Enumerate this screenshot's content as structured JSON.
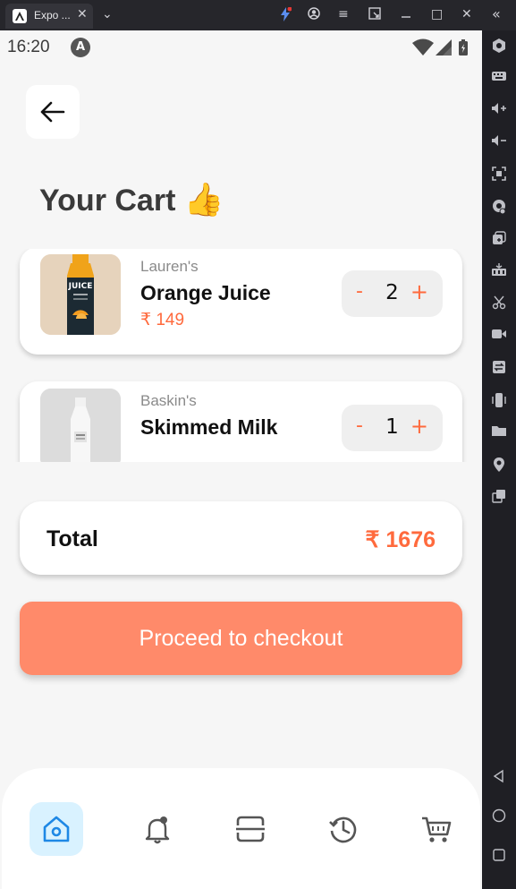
{
  "window": {
    "tab_title": "Expo ...",
    "tab_close": "✕",
    "tab_dropdown": "⌄",
    "controls": [
      "≡",
      "□",
      "✕",
      "«"
    ]
  },
  "status_bar": {
    "time": "16:20",
    "badge": "A"
  },
  "page": {
    "title": "Your Cart",
    "title_emoji": "👍"
  },
  "cart": {
    "items": [
      {
        "brand": "Lauren's",
        "name": "Orange Juice",
        "price": "₹ 149",
        "quantity": "2",
        "image": "juice-bottle"
      },
      {
        "brand": "Baskin's",
        "name": "Skimmed Milk",
        "price": "",
        "quantity": "1",
        "image": "milk-bottle"
      }
    ],
    "minus_label": "-",
    "plus_label": "+",
    "juice_label": "JUICE"
  },
  "total": {
    "label": "Total",
    "value": "₹ 1676"
  },
  "checkout": {
    "label": "Proceed to checkout"
  },
  "nav": {
    "items": [
      "home-icon",
      "bell-icon",
      "scan-icon",
      "history-icon",
      "cart-icon"
    ],
    "active": "home-icon"
  },
  "colors": {
    "accent": "#ff6a3d",
    "checkout_bg": "#ff8a6a",
    "nav_active_bg": "#d9f2ff",
    "nav_icon": "#555555",
    "home_icon": "#1e88e5"
  }
}
